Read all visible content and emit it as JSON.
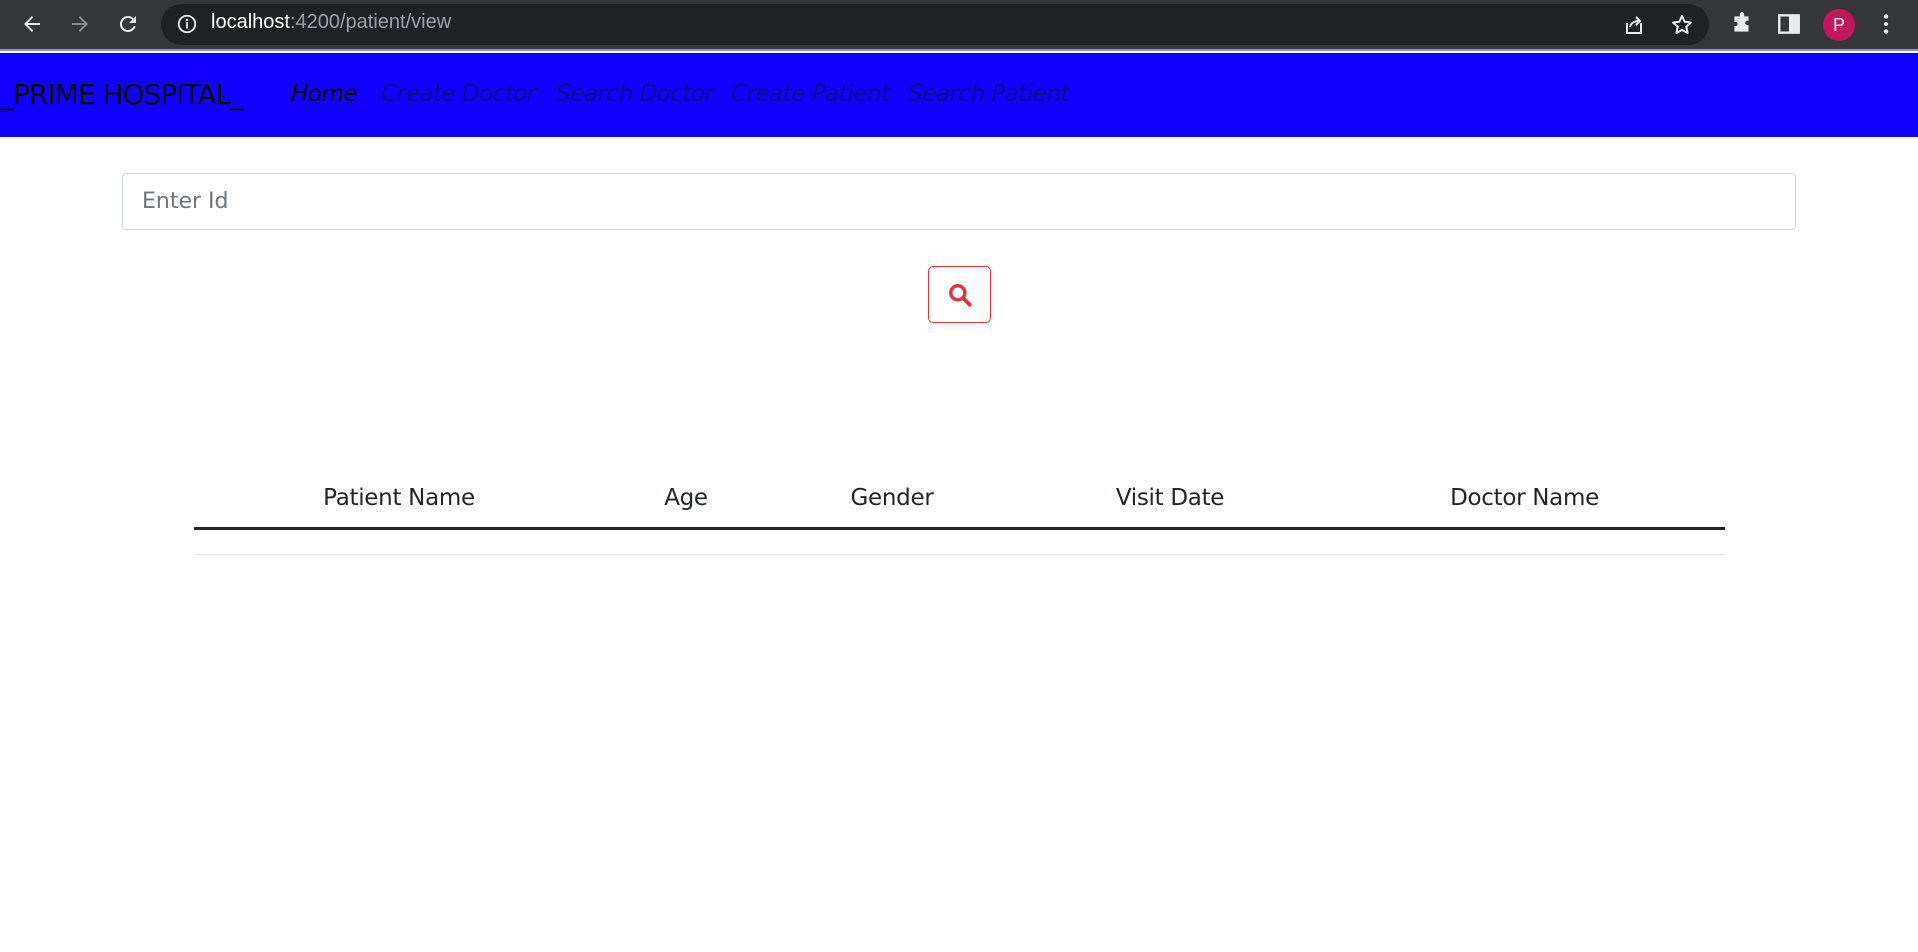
{
  "browser": {
    "url_host": "localhost",
    "url_rest": ":4200/patient/view",
    "profile_initial": "P"
  },
  "navbar": {
    "brand": "_PRIME HOSPITAL_",
    "links": [
      {
        "label": "Home"
      },
      {
        "label": "Create Doctor"
      },
      {
        "label": "Search Doctor"
      },
      {
        "label": "Create Patient"
      },
      {
        "label": "Search Patient"
      }
    ]
  },
  "search": {
    "placeholder": "Enter Id",
    "value": ""
  },
  "table": {
    "headers": [
      "Patient Name",
      "Age",
      "Gender",
      "Visit Date",
      "Doctor Name"
    ],
    "rows": []
  },
  "colors": {
    "navbar_bg": "#1100ff",
    "search_button_accent": "#dc3545"
  }
}
